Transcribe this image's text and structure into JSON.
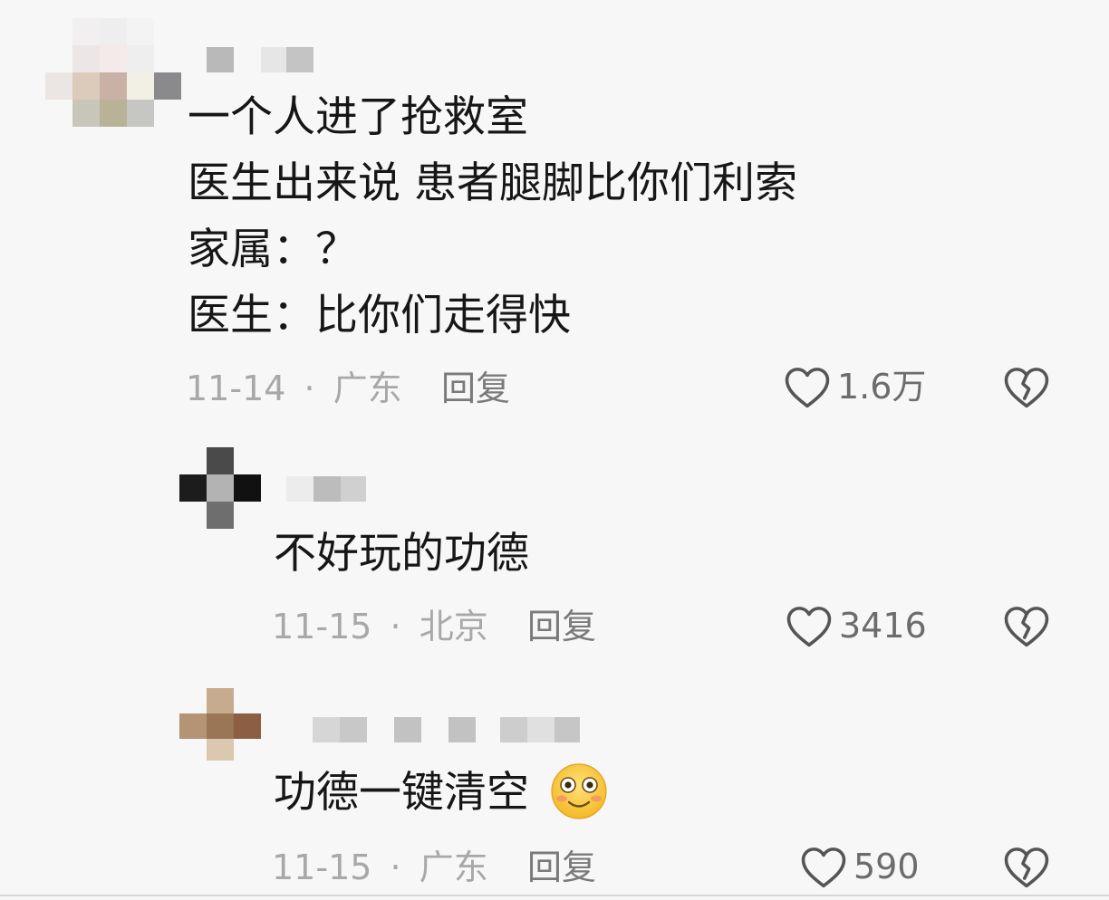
{
  "comments": [
    {
      "lines": [
        "一个人进了抢救室",
        "医生出来说 患者腿脚比你们利索",
        "家属：？",
        "医生：比你们走得快"
      ],
      "date": "11-14",
      "location": "广东",
      "reply_label": "回复",
      "likes": "1.6万",
      "like_icon": "heart-outline-icon",
      "dislike_icon": "broken-heart-icon"
    },
    {
      "lines": [
        "不好玩的功德"
      ],
      "date": "11-15",
      "location": "北京",
      "reply_label": "回复",
      "likes": "3416",
      "like_icon": "heart-outline-icon",
      "dislike_icon": "broken-heart-icon"
    },
    {
      "lines": [
        "功德一键清空"
      ],
      "emoji": "smiling-face-emoji",
      "date": "11-15",
      "location": "广东",
      "reply_label": "回复",
      "likes": "590",
      "like_icon": "heart-outline-icon",
      "dislike_icon": "broken-heart-icon"
    }
  ],
  "separator": "·",
  "colors": {
    "background": "#f7f7f7",
    "text": "#161616",
    "meta": "#a8a8a8",
    "icon": "#555555",
    "emoji": "#f8c93c"
  }
}
